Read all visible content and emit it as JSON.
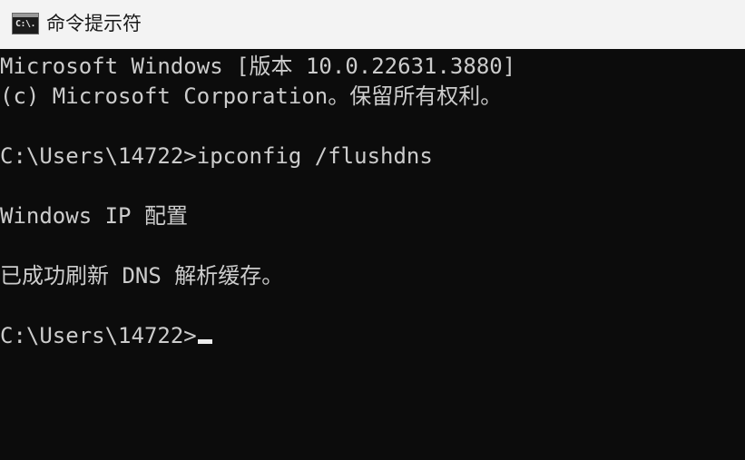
{
  "window": {
    "title": "命令提示符",
    "icon": "cmd-icon",
    "icon_glyph": "C:\\."
  },
  "console": {
    "lines": [
      "Microsoft Windows [版本 10.0.22631.3880]",
      "(c) Microsoft Corporation。保留所有权利。",
      "",
      "C:\\Users\\14722>ipconfig /flushdns",
      "",
      "Windows IP 配置",
      "",
      "已成功刷新 DNS 解析缓存。",
      "",
      "C:\\Users\\14722>"
    ],
    "background_color": "#0c0c0c",
    "text_color": "#cccccc"
  }
}
